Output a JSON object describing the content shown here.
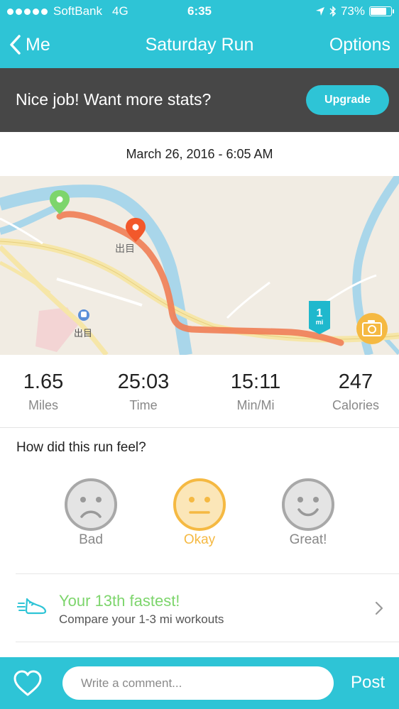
{
  "status_bar": {
    "carrier": "SoftBank",
    "network": "4G",
    "time": "6:35",
    "battery": "73%"
  },
  "nav": {
    "back_label": "Me",
    "title": "Saturday Run",
    "options_label": "Options"
  },
  "promo": {
    "text": "Nice job! Want more stats?",
    "button_label": "Upgrade"
  },
  "run_date": "March 26, 2016 - 6:05 AM",
  "map": {
    "place_label_1": "出目",
    "place_label_2": "出目",
    "mile_marker_value": "1",
    "mile_marker_unit": "mi",
    "route_color": "#f08058",
    "start_pin_color": "#7dd56c",
    "end_pin_color": "#f2582b"
  },
  "stats": [
    {
      "value": "1.65",
      "label": "Miles"
    },
    {
      "value": "25:03",
      "label": "Time"
    },
    {
      "value": "15:11",
      "label": "Min/Mi"
    },
    {
      "value": "247",
      "label": "Calories"
    }
  ],
  "feel": {
    "question": "How did this run feel?",
    "options": [
      {
        "label": "Bad",
        "icon": "sad-face-icon",
        "selected": false
      },
      {
        "label": "Okay",
        "icon": "neutral-face-icon",
        "selected": true
      },
      {
        "label": "Great!",
        "icon": "happy-face-icon",
        "selected": false
      }
    ]
  },
  "achievement": {
    "title": "Your 13th fastest!",
    "subtitle": "Compare your 1-3 mi workouts"
  },
  "comment_bar": {
    "placeholder": "Write a comment...",
    "post_label": "Post"
  },
  "colors": {
    "accent": "#2ec4d6",
    "okay": "#f5b942",
    "success": "#7dd56c"
  }
}
